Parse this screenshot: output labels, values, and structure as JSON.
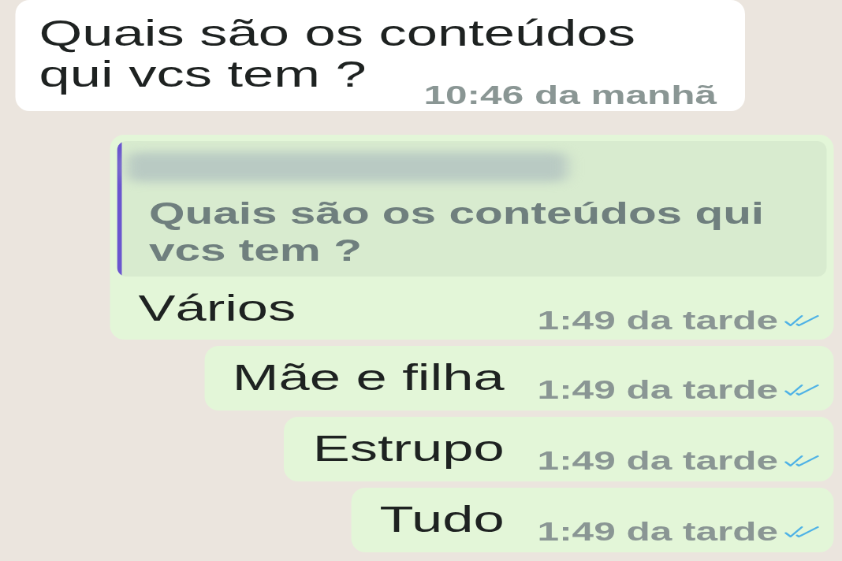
{
  "messages": [
    {
      "kind": "text",
      "outgoing": false,
      "text": "Quais são os conteúdos qui vcs tem ?",
      "time": "10:46 da manhã"
    },
    {
      "kind": "reply",
      "outgoing": true,
      "quote": {
        "sender_redacted": true,
        "text": "Quais são os conteúdos qui vcs tem ?"
      },
      "text": "Vários",
      "time": "1:49 da tarde",
      "read": true
    },
    {
      "kind": "text",
      "outgoing": true,
      "text": "Mãe e filha",
      "time": "1:49 da tarde",
      "read": true
    },
    {
      "kind": "text",
      "outgoing": true,
      "text": "Estrupo",
      "time": "1:49 da tarde",
      "read": true
    },
    {
      "kind": "text",
      "outgoing": true,
      "text": "Tudo",
      "time": "1:49 da tarde",
      "read": true
    }
  ]
}
